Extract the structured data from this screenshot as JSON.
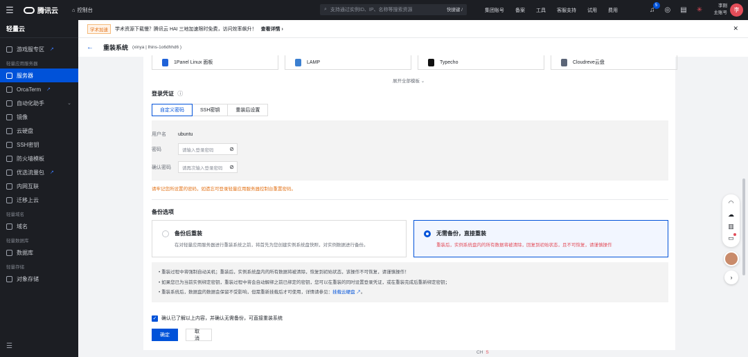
{
  "topbar": {
    "brand": "腾讯云",
    "home": "控制台",
    "search_placeholder": "支持通过实例ID、IP、名称等搜索资源",
    "search_shortcut": "快捷键 /",
    "nav": [
      "集团账号",
      "备案",
      "工具",
      "客服支持",
      "试用",
      "费用"
    ],
    "notification_count": "5",
    "user_name": "李刚",
    "user_role": "主账号",
    "avatar_text": "李"
  },
  "sidebar": {
    "title": "轻量云",
    "items_top": [
      {
        "label": "游戏服专区",
        "external": true
      }
    ],
    "group1": "轻量应用服务器",
    "items1": [
      {
        "label": "服务器",
        "active": true
      },
      {
        "label": "OrcaTerm",
        "external": true
      },
      {
        "label": "自动化助手",
        "chevron": true
      },
      {
        "label": "镜像"
      },
      {
        "label": "云硬盘"
      },
      {
        "label": "SSH密钥"
      },
      {
        "label": "防火墙模板"
      },
      {
        "label": "优选流量包",
        "external": true
      },
      {
        "label": "内网互联"
      },
      {
        "label": "迁移上云"
      }
    ],
    "group2": "轻量域名",
    "items2": [
      {
        "label": "域名"
      }
    ],
    "group3": "轻量数据库",
    "items3": [
      {
        "label": "数据库"
      }
    ],
    "group4": "轻量存储",
    "items4": [
      {
        "label": "对象存储"
      }
    ],
    "ext_glyph": "↗"
  },
  "notice": {
    "tag": "学术加速",
    "text": "学术资源下载慢？腾讯云 HAI 三地加速限时免费，访问效率飙升！",
    "link": "查看详情 ›"
  },
  "header": {
    "title": "重装系统",
    "subtitle": "(xinya | lhins-1o6dhhd6 )"
  },
  "templates": [
    {
      "label": "1Panel Linux 面板",
      "color": "#1f62d8"
    },
    {
      "label": "LAMP",
      "color": "#3b7fd0"
    },
    {
      "label": "Typecho",
      "color": "#111111"
    },
    {
      "label": "Cloudreve云盘",
      "color": "#5b6577"
    }
  ],
  "expand_label": "展开全部模板 ⌄",
  "login": {
    "title": "登录凭证",
    "tabs": [
      "自定义密码",
      "SSH密钥",
      "重装后设置"
    ],
    "username_label": "用户名",
    "username_value": "ubuntu",
    "password_label": "密码",
    "password_placeholder": "请输入登录密码",
    "confirm_label": "确认密码",
    "confirm_placeholder": "请再次输入登录密码",
    "warning": "请牢记您所设置的密码，如遗忘可登录轻量应用服务器控制台重置密码。"
  },
  "backup": {
    "title": "备份选项",
    "option1_title": "备份后重装",
    "option1_desc": "在对轻量应用服务器进行重装系统之前，将首先为您创建实例系统盘快照，对实例数据进行备份。",
    "option2_title": "无需备份，直接重装",
    "option2_desc": "重装后，实例系统盘内的所有数据将被清除，回复到初始状态，且不可恢复，请谨慎操作"
  },
  "info": {
    "line1": "• 重装过程中将强制自动关机；重装后，实例系统盘内的所有数据将被清除，恢复到初始状态，该操作不可恢复，请谨慎操作！",
    "line2": "• 如果您已为当前实例绑定密钥，重装过程中将会自动解绑之前已绑定的密钥，您可以在重装的同时设置登录凭证，或在重装完成后重新绑定密钥；",
    "line3_prefix": "• 重装系统后，数据盘的数据会保留不受影响，但需重新挂载后才可使用，详情请参见：",
    "line3_link": "挂载云硬盘 ↗",
    "line3_suffix": "。"
  },
  "agree": "确认已了解以上内容，并确认无需备份，可直接重装系统",
  "buttons": {
    "confirm": "确定",
    "cancel": "取消"
  },
  "bottom_ime": "CH"
}
